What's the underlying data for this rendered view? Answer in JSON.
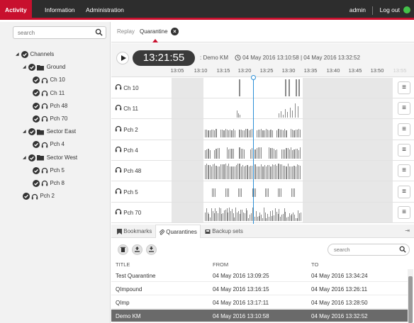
{
  "topbar": {
    "tabs": [
      "Activity",
      "Information",
      "Administration"
    ],
    "user": "admin",
    "logout": "Log out"
  },
  "sidebar": {
    "search_placeholder": "search",
    "tree": [
      {
        "label": "Channels",
        "icon": "none",
        "level": 0,
        "caret": true
      },
      {
        "label": "Ground",
        "icon": "folder-icon",
        "level": 1,
        "caret": true
      },
      {
        "label": "Ch 10",
        "icon": "headphones-icon",
        "level": 2,
        "caret": false
      },
      {
        "label": "Ch 11",
        "icon": "headphones-icon",
        "level": 2,
        "caret": false
      },
      {
        "label": "Pch 48",
        "icon": "headphones-icon",
        "level": 2,
        "caret": false
      },
      {
        "label": "Pch 70",
        "icon": "headphones-icon",
        "level": 2,
        "caret": false
      },
      {
        "label": "Sector East",
        "icon": "folder-icon",
        "level": 1,
        "caret": true
      },
      {
        "label": "Pch 4",
        "icon": "headphones-icon",
        "level": 2,
        "caret": false
      },
      {
        "label": "Sector West",
        "icon": "folder-icon",
        "level": 1,
        "caret": true
      },
      {
        "label": "Pch 5",
        "icon": "headphones-icon",
        "level": 2,
        "caret": false
      },
      {
        "label": "Pch 8",
        "icon": "headphones-icon",
        "level": 2,
        "caret": false
      },
      {
        "label": "Pch 2",
        "icon": "headphones-icon",
        "level": 1,
        "caret": false
      }
    ]
  },
  "breadcrumbs": {
    "replay": "Replay",
    "quarantine": "Quarantine"
  },
  "player": {
    "time": "13:21:55",
    "name": ": Demo KM",
    "range": "04 May 2016 13:10:58  |  04 May 2016 13:32:52",
    "ticks": [
      "13:05",
      "13:10",
      "13:15",
      "13:20",
      "13:25",
      "13:30",
      "13:35",
      "13:40",
      "13:45",
      "13:50",
      "13:55"
    ]
  },
  "tracks": [
    "Ch 10",
    "Ch 11",
    "Pch 2",
    "Pch 4",
    "Pch 48",
    "Pch 5",
    "Pch 70"
  ],
  "bottom_tabs": {
    "bookmarks": "Bookmarks",
    "quarantines": "Quarantines",
    "backup_sets": "Backup sets"
  },
  "list": {
    "search_placeholder": "search",
    "columns": [
      "TITLE",
      "FROM",
      "TO"
    ],
    "rows": [
      {
        "title": "Test Quarantine",
        "from": "04 May 2016 13:09:25",
        "to": "04 May 2016 13:34:24",
        "selected": false
      },
      {
        "title": "QImpound",
        "from": "04 May 2016 13:16:15",
        "to": "04 May 2016 13:26:11",
        "selected": false
      },
      {
        "title": "QImp",
        "from": "04 May 2016 13:17:11",
        "to": "04 May 2016 13:28:50",
        "selected": false
      },
      {
        "title": "Demo KM",
        "from": "04 May 2016 13:10:58",
        "to": "04 May 2016 13:32:52",
        "selected": true
      }
    ]
  },
  "colors": {
    "brand_red": "#c8102e",
    "topbar": "#2d2d2d",
    "status_green": "#44c24a",
    "playhead": "#2b8fd6"
  }
}
